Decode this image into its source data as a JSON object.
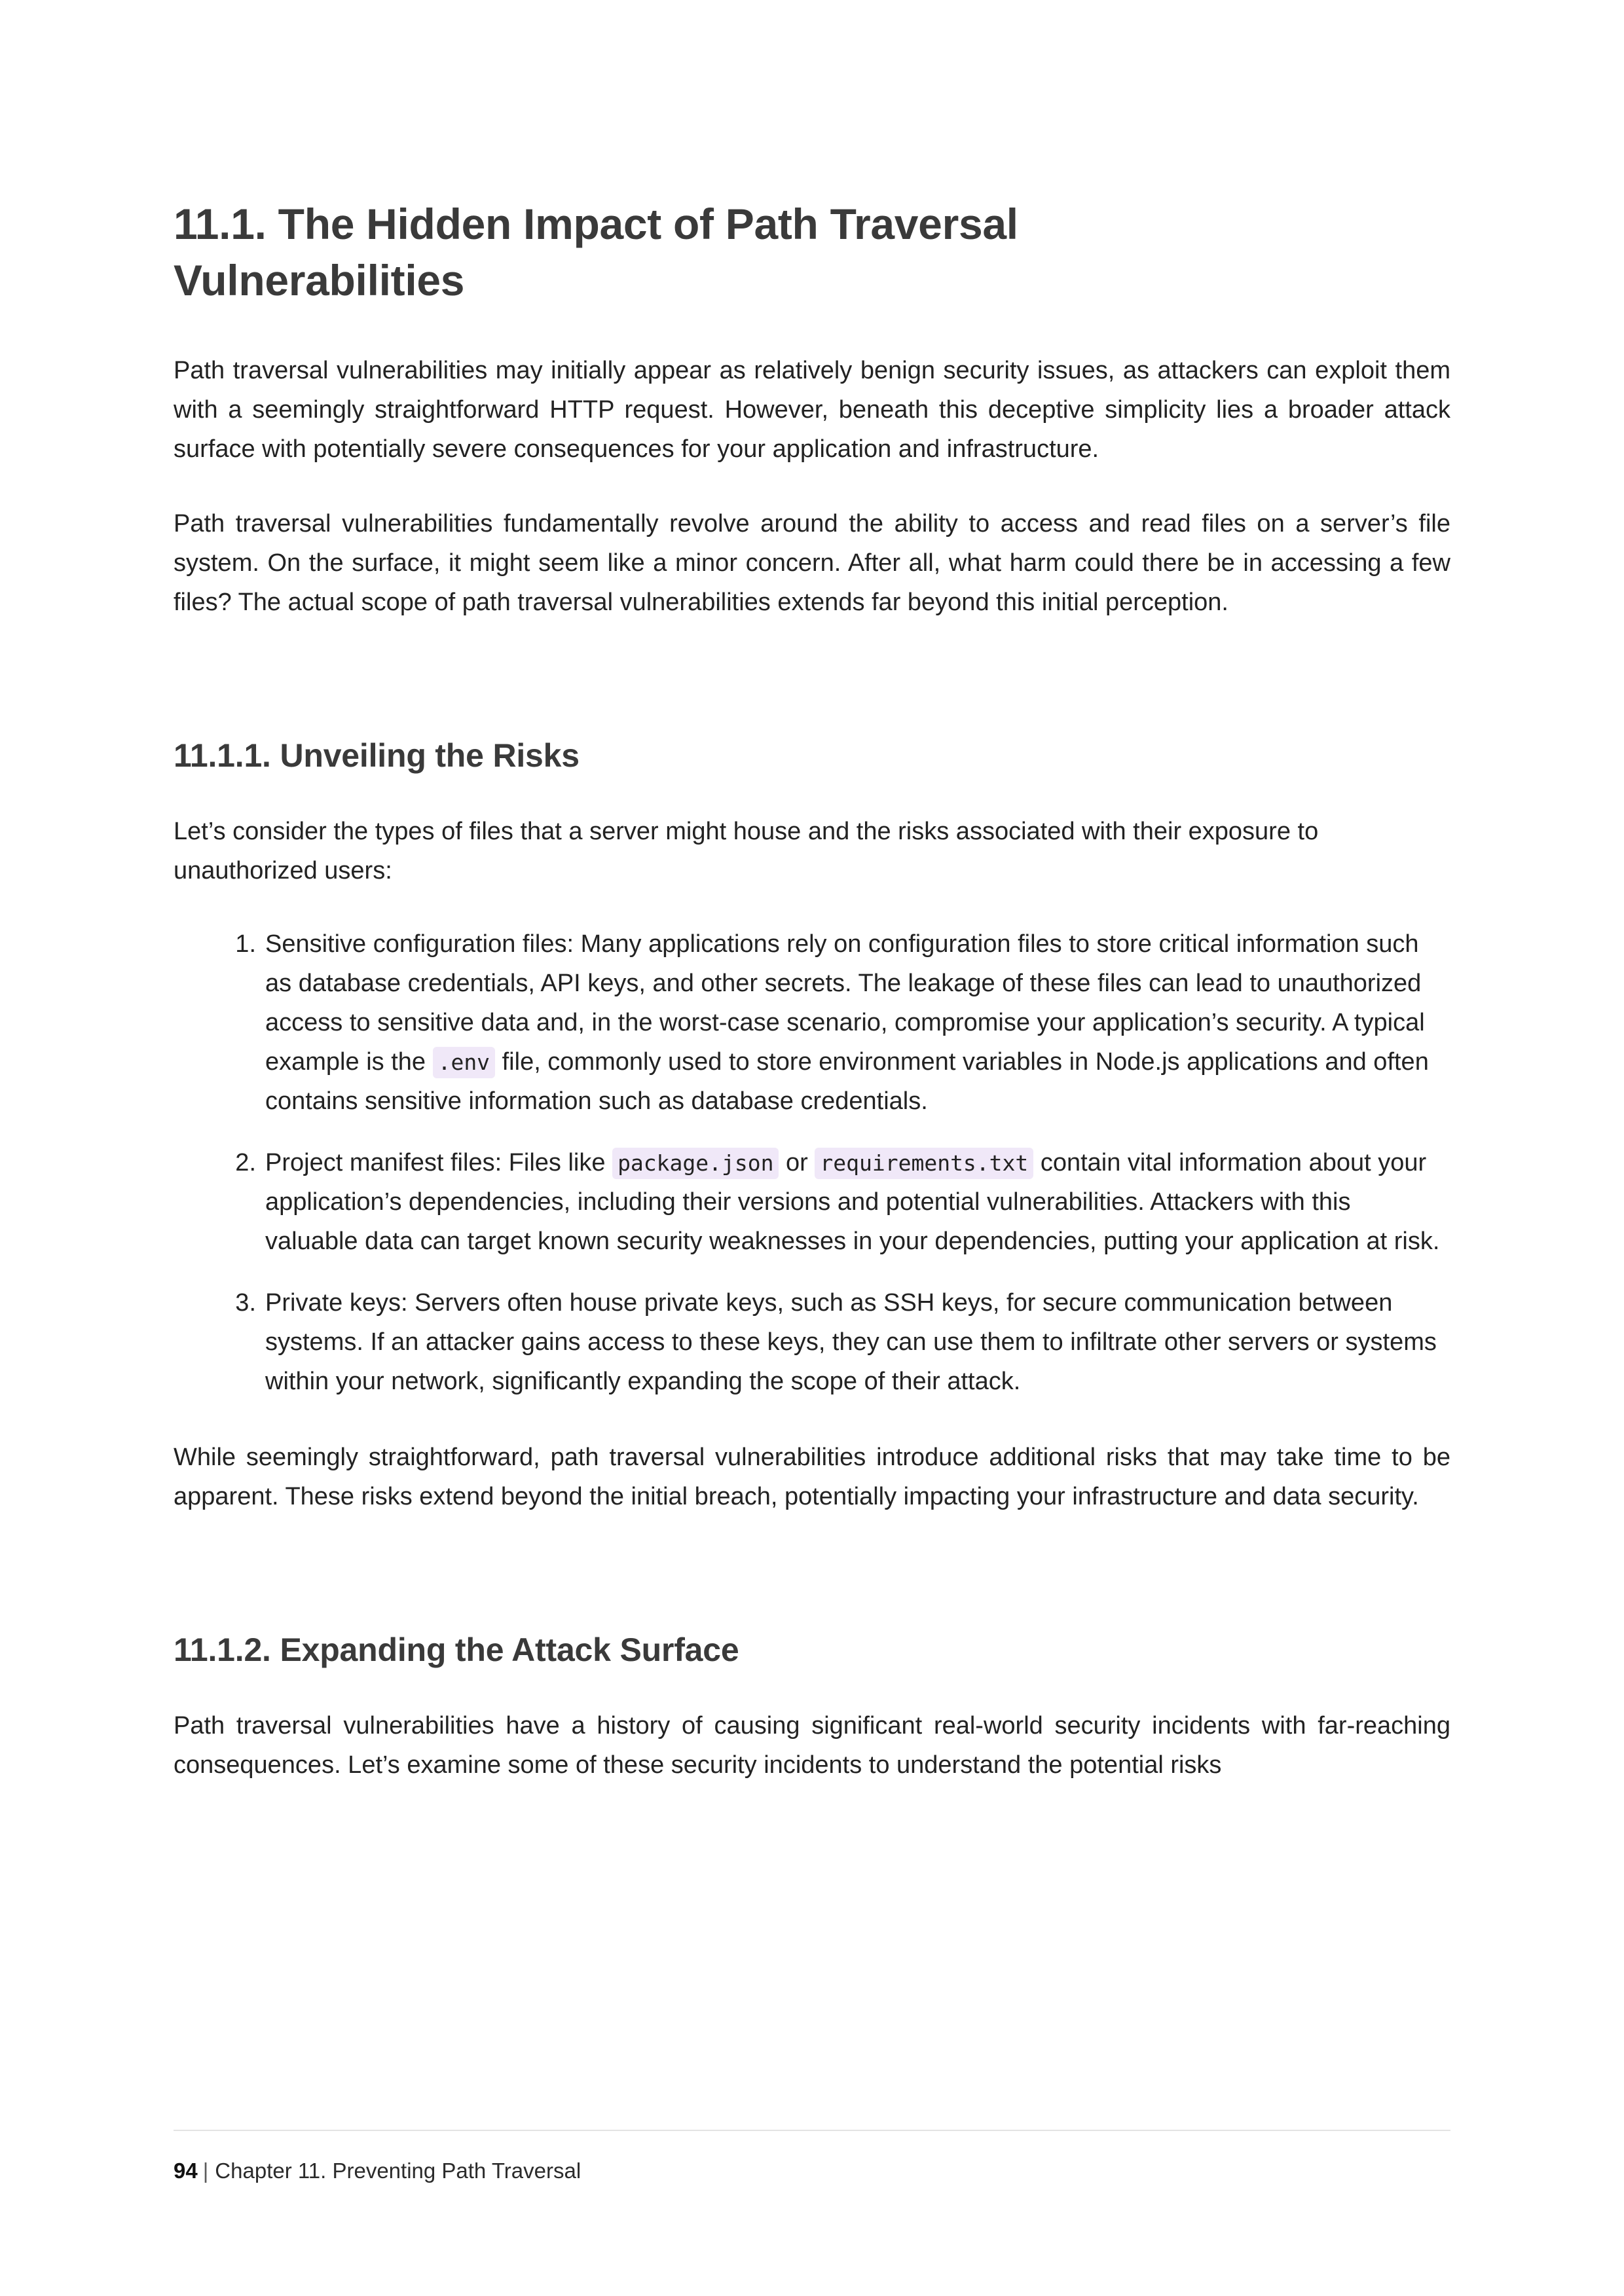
{
  "document": {
    "heading": "11.1. The Hidden Impact of Path Traversal Vulnerabilities",
    "paragraph_1": "Path traversal vulnerabilities may initially appear as relatively benign security issues, as attackers can exploit them with a seemingly straightforward HTTP request. However, beneath this deceptive simplicity lies a broader attack surface with potentially severe consequences for your application and infrastructure.",
    "paragraph_2": "Path traversal vulnerabilities fundamentally revolve around the ability to access and read files on a server’s file system. On the surface, it might seem like a minor concern. After all, what harm could there be in accessing a few files? The actual scope of path traversal vulnerabilities extends far beyond this initial perception."
  },
  "section_unveiling": {
    "heading": "11.1.1. Unveiling the Risks",
    "lead_in": "Let’s consider the types of files that a server might house and the risks associated with their exposure to unauthorized users:",
    "items": [
      {
        "part_1": "Sensitive configuration files: Many applications rely on configuration files to store critical information such as database credentials, API keys, and other secrets. The leakage of these files can lead to unauthorized access to sensitive data and, in the worst-case scenario, compromise your application’s security. A typical example is the ",
        "code_1": ".env",
        "part_2": " file, commonly used to store environment variables in Node.js applications and often contains sensitive information such as database credentials."
      },
      {
        "part_1": "Project manifest files: Files like ",
        "code_1": "package.json",
        "part_2": " or ",
        "code_2": "requirements.txt",
        "part_3": " contain vital information about your application’s dependencies, including their versions and potential vulnerabilities. Attackers with this valuable data can target known security weaknesses in your dependencies, putting your application at risk."
      },
      {
        "part_1": "Private keys: Servers often house private keys, such as SSH keys, for secure communication between systems. If an attacker gains access to these keys, they can use them to infiltrate other servers or systems within your network, significantly expanding the scope of their attack."
      }
    ],
    "closing_paragraph": "While seemingly straightforward, path traversal vulnerabilities introduce additional risks that may take time to be apparent. These risks extend beyond the initial breach, potentially impacting your infrastructure and data security."
  },
  "section_expanding": {
    "heading": "11.1.2. Expanding the Attack Surface",
    "paragraph_1": "Path traversal vulnerabilities have a history of causing significant real-world security incidents with far-reaching consequences. Let’s examine some of these security incidents to understand the potential risks"
  },
  "footer": {
    "page_number": "94",
    "separator": "|",
    "chapter_label": "Chapter 11. Preventing Path Traversal"
  },
  "colors": {
    "heading": "#3a3a3a",
    "body_text": "#222222",
    "inline_code_background": "#f0e8f8",
    "footer_rule": "#e3e3e3",
    "page_background": "#ffffff"
  }
}
